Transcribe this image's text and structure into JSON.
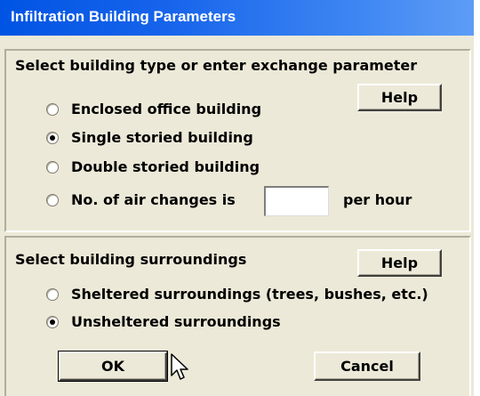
{
  "window": {
    "title": "Infiltration Building Parameters"
  },
  "building": {
    "heading": "Select building type or enter exchange parameter",
    "help_label": "Help",
    "options": [
      {
        "label": "Enclosed office building",
        "checked": false
      },
      {
        "label": "Single storied building",
        "checked": true
      },
      {
        "label": "Double storied building",
        "checked": false
      },
      {
        "label": "No. of air changes is",
        "checked": false
      }
    ],
    "air_changes_value": "",
    "per_hour_label": "per hour"
  },
  "surroundings": {
    "heading": "Select building surroundings",
    "help_label": "Help",
    "options": [
      {
        "label": "Sheltered surroundings (trees, bushes, etc.)",
        "checked": false
      },
      {
        "label": "Unsheltered surroundings",
        "checked": true
      }
    ]
  },
  "buttons": {
    "ok_label": "OK",
    "cancel_label": "Cancel"
  },
  "icons": {
    "cursor": "arrow-cursor-icon",
    "radio": "radio-button-icon"
  }
}
